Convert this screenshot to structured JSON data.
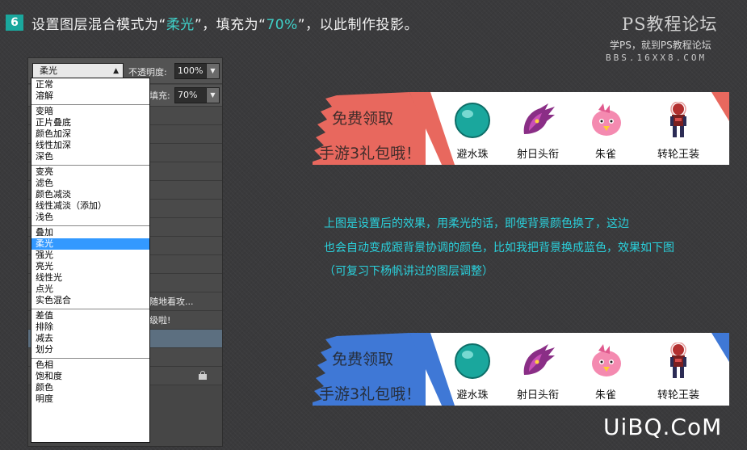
{
  "header": {
    "step_number": "6",
    "title_prefix": "设置图层混合模式为“",
    "title_highlight_mode": "柔光",
    "title_middle": "”，填充为“",
    "title_highlight_fill": "70%",
    "title_suffix": "”，以此制作投影。",
    "highlight_color": "#3fd0c8"
  },
  "logo": {
    "main": "PS教程论坛",
    "sub": "学PS，就到PS教程论坛",
    "url": "BBS.16XX8.COM"
  },
  "layers_panel": {
    "blend_mode_value": "柔光",
    "opacity_label": "不透明度:",
    "opacity_value": "100%",
    "fill_label": "填充:",
    "fill_value": "70%",
    "layer_texts": [
      "随地看攻...",
      "级啦!"
    ]
  },
  "blend_modes": {
    "groups": [
      [
        "正常",
        "溶解"
      ],
      [
        "变暗",
        "正片叠底",
        "颜色加深",
        "线性加深",
        "深色"
      ],
      [
        "变亮",
        "滤色",
        "颜色减淡",
        "线性减淡（添加）",
        "浅色"
      ],
      [
        "叠加",
        "柔光",
        "强光",
        "亮光",
        "线性光",
        "点光",
        "实色混合"
      ],
      [
        "差值",
        "排除",
        "减去",
        "划分"
      ],
      [
        "色相",
        "饱和度",
        "颜色",
        "明度"
      ]
    ],
    "selected": "柔光",
    "selected_color": "#3399ff"
  },
  "banner_top": {
    "title": "免费领取",
    "subtitle": "手游3礼包哦！",
    "accent_color": "#e8685e",
    "prizes": [
      "避水珠",
      "射日头衔",
      "朱雀",
      "转轮王装"
    ]
  },
  "banner_bottom": {
    "title": "免费领取",
    "subtitle": "手游3礼包哦！",
    "accent_color": "#3f78d6",
    "prizes": [
      "避水珠",
      "射日头衔",
      "朱雀",
      "转轮王装"
    ]
  },
  "description": {
    "line1": "上图是设置后的效果，用柔光的话，即使背景颜色换了，这边",
    "line2": "也会自动变成跟背景协调的颜色，比如我把背景换成蓝色，效果如下图",
    "line3": "（可复习下杨帆讲过的图层调整）",
    "color": "#2ad1dc"
  },
  "watermark": "UiBQ.CoM"
}
